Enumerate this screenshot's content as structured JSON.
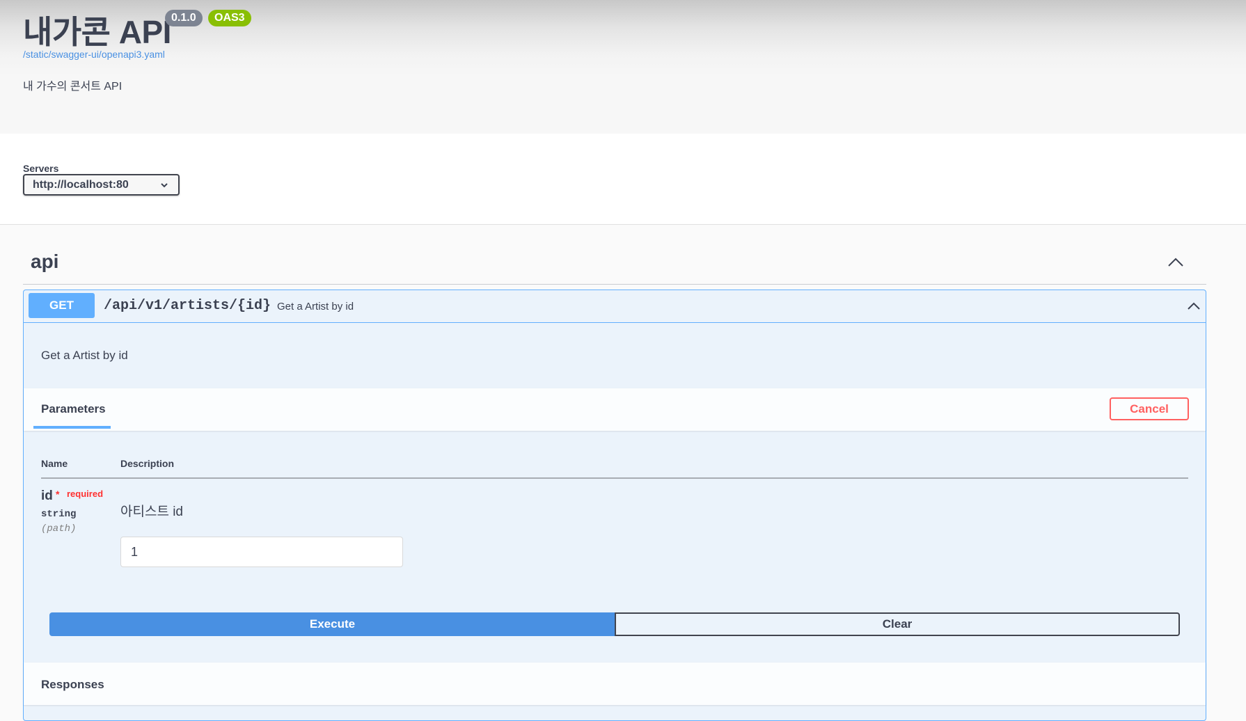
{
  "info": {
    "title": "내가콘 API",
    "version": "0.1.0",
    "oas_badge": "OAS3",
    "spec_link": "/static/swagger-ui/openapi3.yaml",
    "description": "내 가수의 콘서트 API"
  },
  "servers": {
    "label": "Servers",
    "selected": "http://localhost:80"
  },
  "tag": {
    "name": "api",
    "expanded": true
  },
  "operation": {
    "method": "GET",
    "path": "/api/v1/artists/{id}",
    "summary": "Get a Artist by id",
    "description": "Get a Artist by id",
    "colors": {
      "method": "#61affe",
      "background": "#ebf3fb"
    }
  },
  "parameters": {
    "tab_label": "Parameters",
    "cancel_label": "Cancel",
    "headers": {
      "name": "Name",
      "description": "Description"
    },
    "items": [
      {
        "name": "id",
        "required_star": "*",
        "required_label": "required",
        "type": "string",
        "in": "(path)",
        "description": "아티스트 id",
        "value": "1"
      }
    ]
  },
  "actions": {
    "execute_label": "Execute",
    "clear_label": "Clear"
  },
  "responses": {
    "title": "Responses"
  }
}
